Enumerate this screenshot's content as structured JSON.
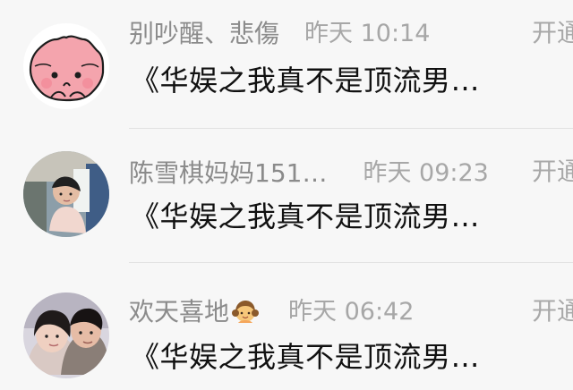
{
  "messages": [
    {
      "name": "别吵醒、悲傷",
      "time": "昨天 10:14",
      "preview": "《华娱之我真不是顶流男…",
      "action": "开通"
    },
    {
      "name": "陈雪棋妈妈151…",
      "time": "昨天 09:23",
      "preview": "《华娱之我真不是顶流男…",
      "action": "开通"
    },
    {
      "name": "欢天喜地",
      "emoji": "girl-emoji",
      "time": "昨天 06:42",
      "preview": "《华娱之我真不是顶流男…",
      "action": "开通"
    }
  ]
}
